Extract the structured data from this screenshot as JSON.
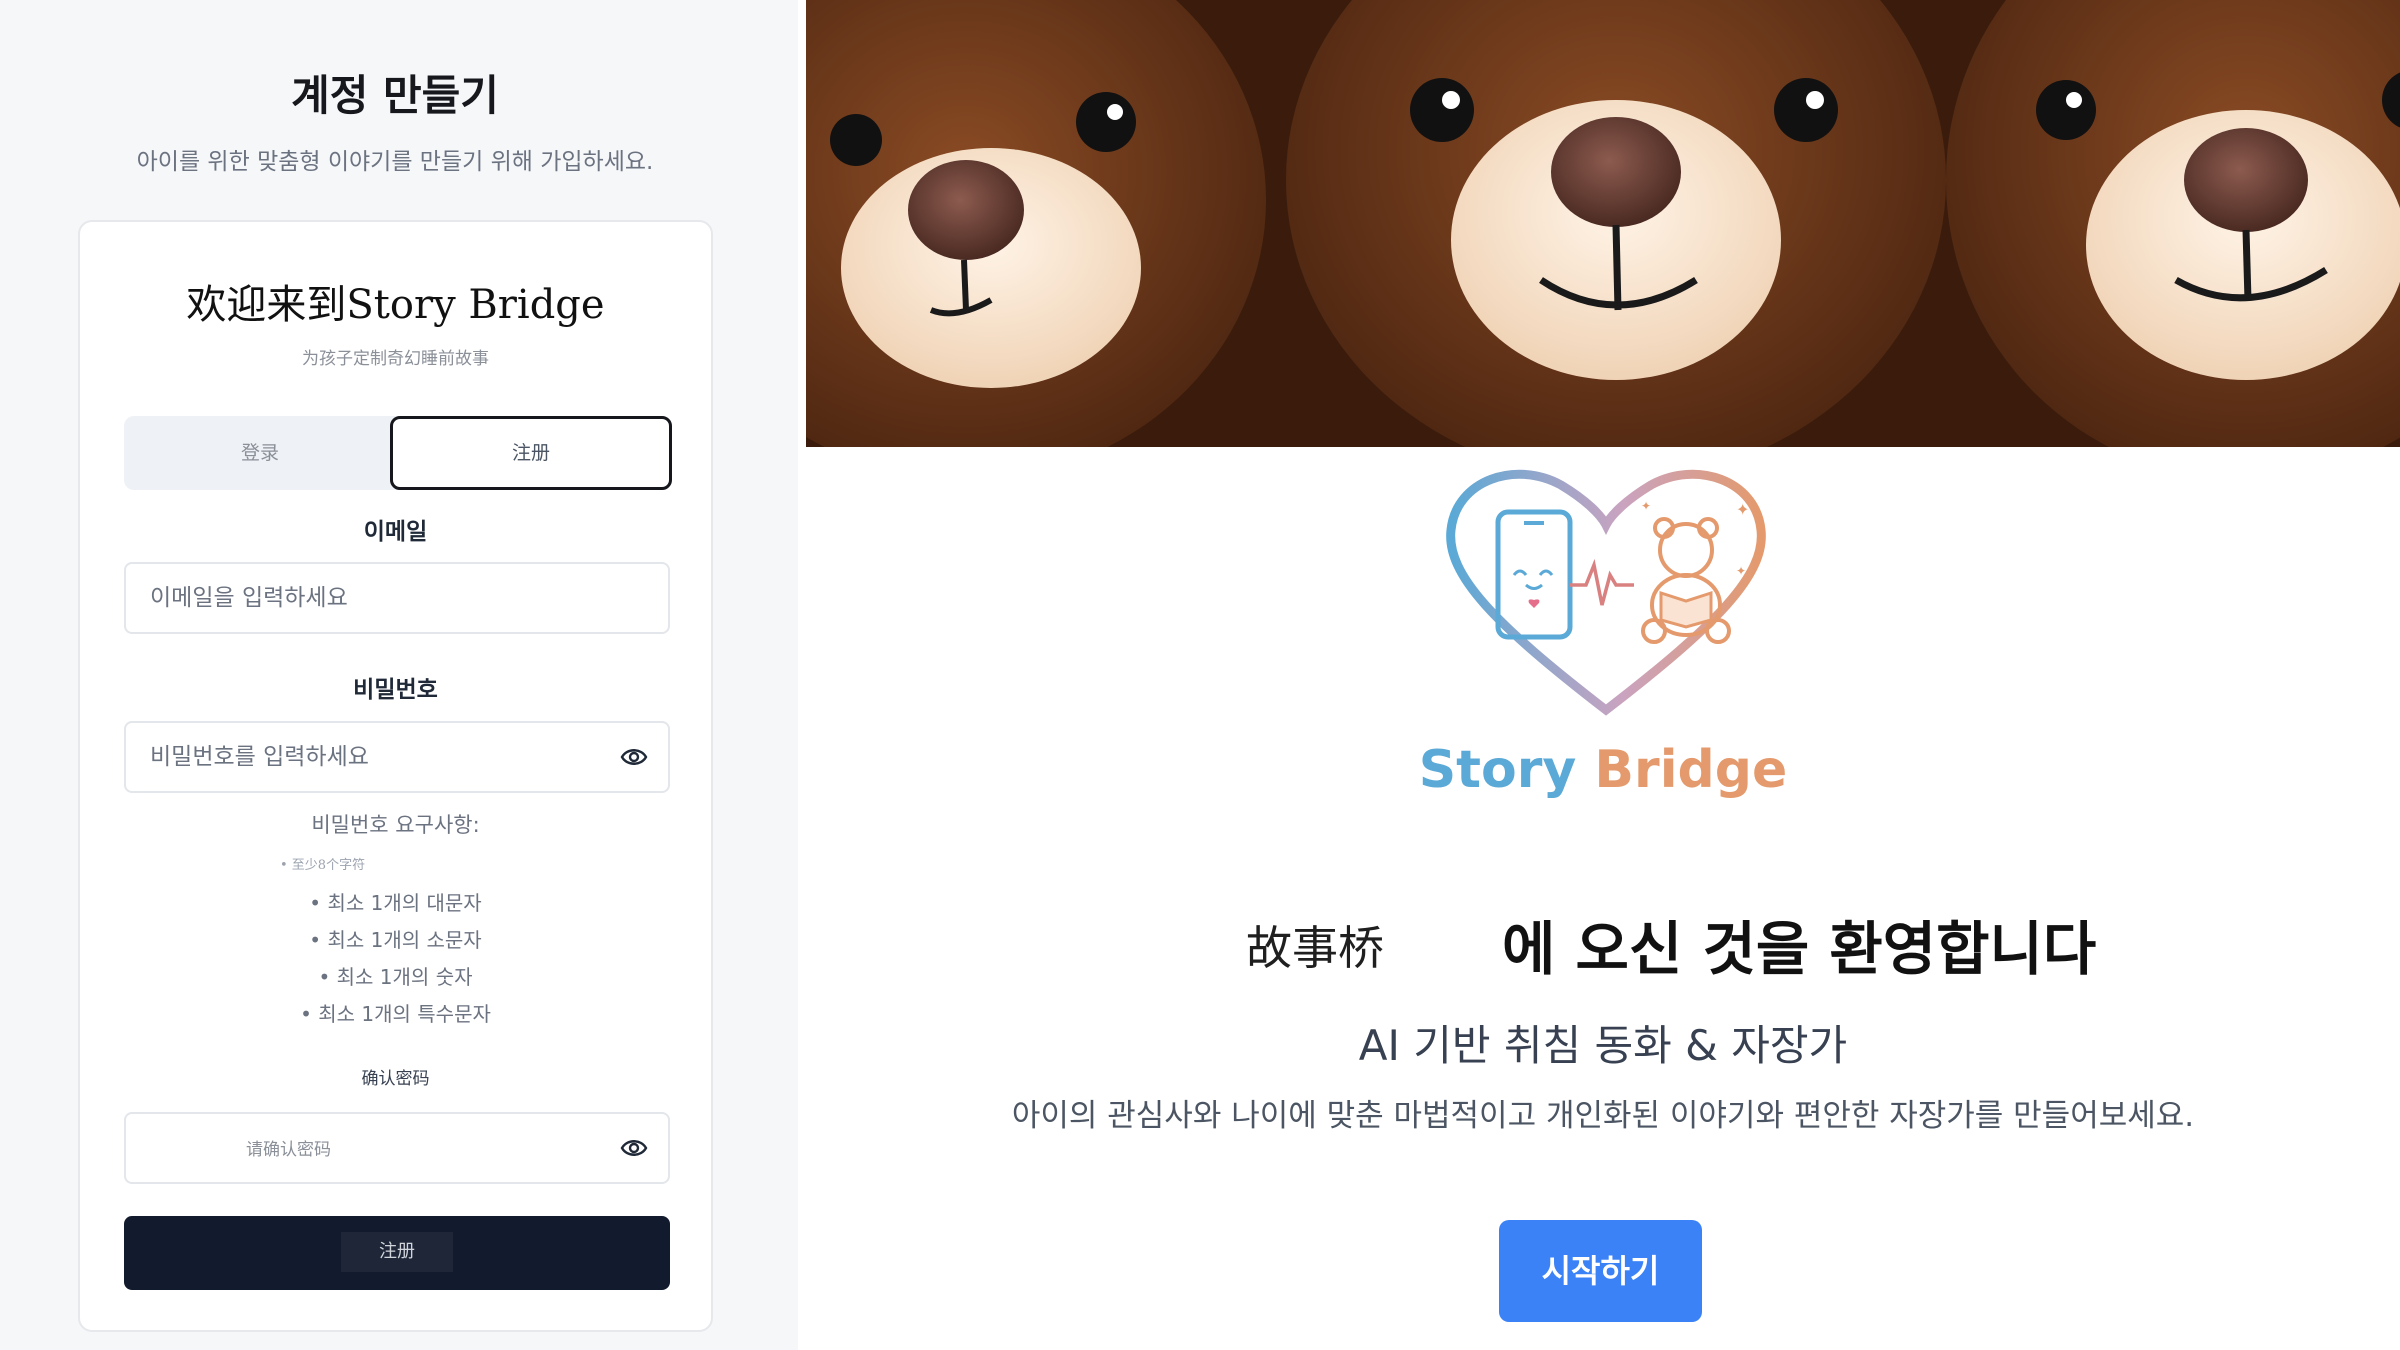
{
  "signup": {
    "title": "계정 만들기",
    "subtitle": "아이를 위한 맞춤형 이야기를 만들기 위해 가입하세요.",
    "card_title": "欢迎来到Story Bridge",
    "card_subtitle": "为孩子定制奇幻睡前故事",
    "tabs": [
      {
        "label": "登录",
        "active": false
      },
      {
        "label": "注册",
        "active": true
      }
    ],
    "email_label": "이메일",
    "email_placeholder": "이메일을 입력하세요",
    "password_label": "비밀번호",
    "password_placeholder": "비밀번호를 입력하세요",
    "requirements_title": "비밀번호 요구사항:",
    "requirements": [
      "• 至少8个字符",
      "• 최소 1개의 대문자",
      "• 최소 1개의 소문자",
      "• 최소 1개의 숫자",
      "• 최소 1개의 특수문자"
    ],
    "confirm_label": "确认密码",
    "confirm_placeholder": "请确认密码",
    "submit_label": "注册"
  },
  "landing": {
    "brand_part1": "Story",
    "brand_part2": "Bridge",
    "welcome_cn": "故事桥",
    "welcome_ko": "에 오신 것을 환영합니다",
    "tagline": "AI 기반 취침 동화 & 자장가",
    "description": "아이의 관심사와 나이에 맞춘 마법적이고 개인화된 이야기와 편안한 자장가를 만들어보세요.",
    "start_label": "시작하기",
    "hero_image": "teddy-bears-photo"
  },
  "colors": {
    "primary_dark": "#121a2e",
    "start_button": "#3b82f6",
    "brand_blue": "#5aa9d6",
    "brand_orange": "#e49a6c"
  }
}
